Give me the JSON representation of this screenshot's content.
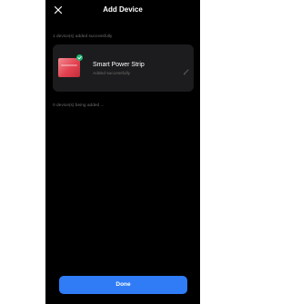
{
  "header": {
    "title": "Add Device",
    "close_icon": "close-icon"
  },
  "added_section": {
    "label": "1 device(s) added successfully"
  },
  "device": {
    "name": "Smart Power Strip",
    "status": "Added successfully",
    "badge_icon": "check-icon",
    "edit_icon": "pencil-icon",
    "thumbnail_color": "#e34250"
  },
  "adding_section": {
    "label": "0 device(s) being added ..."
  },
  "footer": {
    "done_label": "Done",
    "accent_color": "#2f7cf6"
  },
  "colors": {
    "background": "#000000",
    "card": "#1c1c1e",
    "success": "#22b573",
    "muted_text": "#6e6e6e"
  }
}
